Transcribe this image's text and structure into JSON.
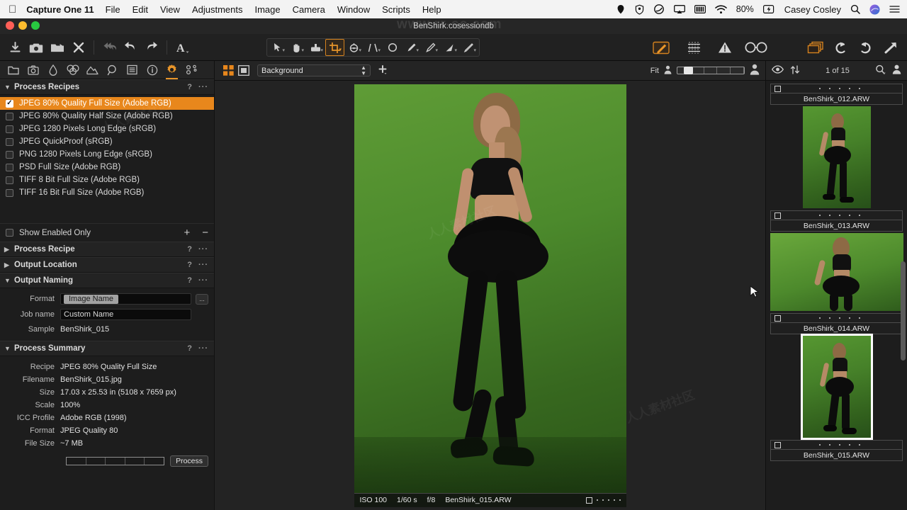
{
  "menubar": {
    "apple_icon": "apple-logo-icon",
    "app_title": "Capture One 11",
    "items": [
      "File",
      "Edit",
      "View",
      "Adjustments",
      "Image",
      "Camera",
      "Window",
      "Scripts",
      "Help"
    ],
    "status_icons": [
      "dropbox-icon",
      "location-icon",
      "creative-cloud-icon",
      "airplay-icon",
      "battery-bar-icon",
      "wifi-icon"
    ],
    "battery": "80%",
    "charging_icon": "charging-bolt-icon",
    "user": "Casey Cosley",
    "search_icon": "search-icon",
    "siri_icon": "siri-icon",
    "notification_icon": "notification-center-icon"
  },
  "window": {
    "title": "BenShirk.cosessiondb",
    "watermark": "www.rr-sc.com"
  },
  "toolbar": {
    "left_icons": [
      "import-icon",
      "capture-icon",
      "new-folder-icon",
      "delete-icon"
    ],
    "history_icons": [
      "undo-all-icon",
      "undo-icon",
      "redo-icon"
    ],
    "text_tool_icon": "annotation-A-icon",
    "cursor_tools": [
      {
        "name": "select-tool",
        "icon": "pointer-icon",
        "active": false
      },
      {
        "name": "pan-tool",
        "icon": "hand-icon",
        "active": false
      },
      {
        "name": "white-balance-tool",
        "icon": "eyedropper-box-icon",
        "active": false
      },
      {
        "name": "crop-tool",
        "icon": "crop-icon",
        "active": true
      },
      {
        "name": "rotate-tool",
        "icon": "rotate-angle-icon",
        "active": false
      },
      {
        "name": "keystone-tool",
        "icon": "keystone-icon",
        "active": false
      },
      {
        "name": "spot-removal-tool",
        "icon": "circle-icon",
        "active": false
      },
      {
        "name": "draw-mask-tool",
        "icon": "brush-icon",
        "active": false
      },
      {
        "name": "erase-mask-tool",
        "icon": "eraser-brush-icon",
        "active": false
      },
      {
        "name": "gradient-mask-tool",
        "icon": "gradient-brush-icon",
        "active": false
      },
      {
        "name": "heal-tool",
        "icon": "heal-pen-icon",
        "active": false
      }
    ],
    "right_tools": [
      {
        "name": "edit-mask-tool",
        "icon": "pencil-box-icon",
        "active": true
      },
      {
        "name": "grid-tool",
        "icon": "grid-icon",
        "active": false
      },
      {
        "name": "clipping-warning-tool",
        "icon": "warning-triangle-icon",
        "active": false
      },
      {
        "name": "focus-mask-tool",
        "icon": "glasses-icon",
        "active": false
      }
    ],
    "far_right_tools": [
      {
        "name": "variants-tool",
        "icon": "stacked-layers-icon",
        "active": true
      },
      {
        "name": "rotate-left",
        "icon": "rotate-ccw-icon",
        "active": false
      },
      {
        "name": "rotate-right",
        "icon": "rotate-cw-icon",
        "active": false
      },
      {
        "name": "export-icon",
        "icon": "arrow-up-right-icon",
        "active": false
      },
      {
        "name": "import-arrow-icon",
        "icon": "arrow-in-icon",
        "active": false
      }
    ]
  },
  "tool_tabs": [
    {
      "name": "library-tab",
      "icon": "folder-icon",
      "active": false
    },
    {
      "name": "capture-tab",
      "icon": "camera-icon",
      "active": false
    },
    {
      "name": "lens-tab",
      "icon": "lens-droplet-icon",
      "active": false
    },
    {
      "name": "color-tab",
      "icon": "color-circles-icon",
      "active": false
    },
    {
      "name": "exposure-tab",
      "icon": "exposure-curve-icon",
      "active": false
    },
    {
      "name": "details-tab",
      "icon": "magnifier-icon",
      "active": false
    },
    {
      "name": "metadata-tab",
      "icon": "list-icon",
      "active": false
    },
    {
      "name": "adjustments-info-tab",
      "icon": "info-circle-icon",
      "active": false
    },
    {
      "name": "output-tab",
      "icon": "gear-icon",
      "active": true
    },
    {
      "name": "batch-tab",
      "icon": "nodes-icon",
      "active": false
    }
  ],
  "process_recipes": {
    "title": "Process Recipes",
    "help_glyph": "?",
    "menu_glyph": "···",
    "items": [
      {
        "label": "JPEG 80% Quality Full Size (Adobe RGB)",
        "checked": true,
        "selected": true
      },
      {
        "label": "JPEG 80% Quality Half Size (Adobe RGB)",
        "checked": false,
        "selected": false
      },
      {
        "label": "JPEG 1280 Pixels Long Edge (sRGB)",
        "checked": false,
        "selected": false
      },
      {
        "label": "JPEG QuickProof (sRGB)",
        "checked": false,
        "selected": false
      },
      {
        "label": "PNG 1280 Pixels Long Edge (sRGB)",
        "checked": false,
        "selected": false
      },
      {
        "label": "PSD Full Size (Adobe RGB)",
        "checked": false,
        "selected": false
      },
      {
        "label": "TIFF 8 Bit Full Size (Adobe RGB)",
        "checked": false,
        "selected": false
      },
      {
        "label": "TIFF 16 Bit Full Size (Adobe RGB)",
        "checked": false,
        "selected": false
      }
    ],
    "show_enabled_only": "Show Enabled Only",
    "add_glyph": "+",
    "remove_glyph": "−"
  },
  "collapsed_sections": [
    {
      "title": "Process Recipe"
    },
    {
      "title": "Output Location"
    }
  ],
  "output_naming": {
    "title": "Output Naming",
    "format_label": "Format",
    "format_token": "Image Name",
    "format_more": "...",
    "job_label": "Job name",
    "job_placeholder": "Custom Name",
    "sample_label": "Sample",
    "sample_value": "BenShirk_015"
  },
  "process_summary": {
    "title": "Process Summary",
    "rows": [
      {
        "key": "Recipe",
        "value": "JPEG 80% Quality Full Size"
      },
      {
        "key": "Filename",
        "value": "BenShirk_015.jpg"
      },
      {
        "key": "Size",
        "value": "17.03 x 25.53 in (5108 x 7659 px)"
      },
      {
        "key": "Scale",
        "value": "100%"
      },
      {
        "key": "ICC Profile",
        "value": "Adobe RGB (1998)"
      },
      {
        "key": "Format",
        "value": "JPEG Quality 80"
      },
      {
        "key": "File Size",
        "value": "~7 MB"
      }
    ],
    "process_button": "Process"
  },
  "viewer_bar": {
    "grid_view_icon": "grid-view-icon",
    "single_view_icon": "single-view-icon",
    "collection": "Background",
    "add_icon": "add-variant-icon",
    "fit_label": "Fit",
    "zoom_small_icon": "person-small-icon",
    "zoom_large_icon": "person-large-icon"
  },
  "browser_bar": {
    "eye_icon": "eye-icon",
    "sort_icon": "sort-arrows-icon",
    "count": "1 of 15",
    "search_icon": "search-icon",
    "person_icon": "person-icon"
  },
  "image_info": {
    "iso": "ISO 100",
    "shutter": "1/60 s",
    "aperture": "f/8",
    "filename": "BenShirk_015.ARW",
    "rating_dots": 5
  },
  "thumbnails": [
    {
      "filename": "BenShirk_012.ARW",
      "selected": false,
      "has_image": false
    },
    {
      "filename": "BenShirk_013.ARW",
      "selected": false,
      "has_image": true
    },
    {
      "filename": "BenShirk_014.ARW",
      "selected": false,
      "has_image": true
    },
    {
      "filename": "BenShirk_015.ARW",
      "selected": true,
      "has_image": true
    }
  ],
  "colors": {
    "accent": "#e8871c",
    "panel": "#1d1d1d",
    "toolbar": "#212121",
    "green_backdrop": "#4a8a2e",
    "text": "#d9d9d9"
  },
  "watermarks": [
    "人人素材社区",
    "人人素材社区",
    "人人素材社区"
  ]
}
